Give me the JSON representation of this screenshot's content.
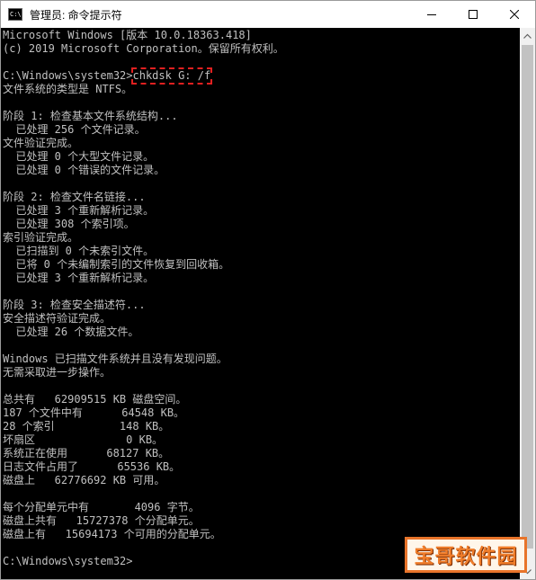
{
  "window": {
    "title": "管理员: 命令提示符",
    "icon_text": "C:\\",
    "controls": [
      "minimize-icon",
      "maximize-icon",
      "close-icon"
    ]
  },
  "console": {
    "prompt_line_prefix": "C:\\Windows\\system32>",
    "command": "chkdsk G: /f",
    "lines": [
      "Microsoft Windows [版本 10.0.18363.418]",
      "(c) 2019 Microsoft Corporation。保留所有权利。",
      "",
      "",
      "文件系统的类型是 NTFS。",
      "",
      "阶段 1: 检查基本文件系统结构...",
      "  已处理 256 个文件记录。",
      "文件验证完成。",
      "  已处理 0 个大型文件记录。",
      "  已处理 0 个错误的文件记录。",
      "",
      "阶段 2: 检查文件名链接...",
      "  已处理 3 个重新解析记录。",
      "  已处理 308 个索引项。",
      "索引验证完成。",
      "  已扫描到 0 个未索引文件。",
      "  已将 0 个未编制索引的文件恢复到回收箱。",
      "  已处理 3 个重新解析记录。",
      "",
      "阶段 3: 检查安全描述符...",
      "安全描述符验证完成。",
      "  已处理 26 个数据文件。",
      "",
      "Windows 已扫描文件系统并且没有发现问题。",
      "无需采取进一步操作。",
      "",
      "总共有   62909515 KB 磁盘空间。",
      "187 个文件中有      64548 KB。",
      "28 个索引          148 KB。",
      "坏扇区              0 KB。",
      "系统正在使用      68127 KB。",
      "日志文件占用了      65536 KB。",
      "磁盘上   62776692 KB 可用。",
      "",
      "每个分配单元中有       4096 字节。",
      "磁盘上共有   15727378 个分配单元。",
      "磁盘上有   15694173 个可用的分配单元。",
      "",
      "C:\\Windows\\system32>"
    ]
  },
  "watermark": {
    "text": "宝哥软件园"
  },
  "colors": {
    "console_bg": "#000000",
    "console_text": "#c0c0c0",
    "command_highlight": "#e02020",
    "watermark_orange": "#f07d2a"
  }
}
